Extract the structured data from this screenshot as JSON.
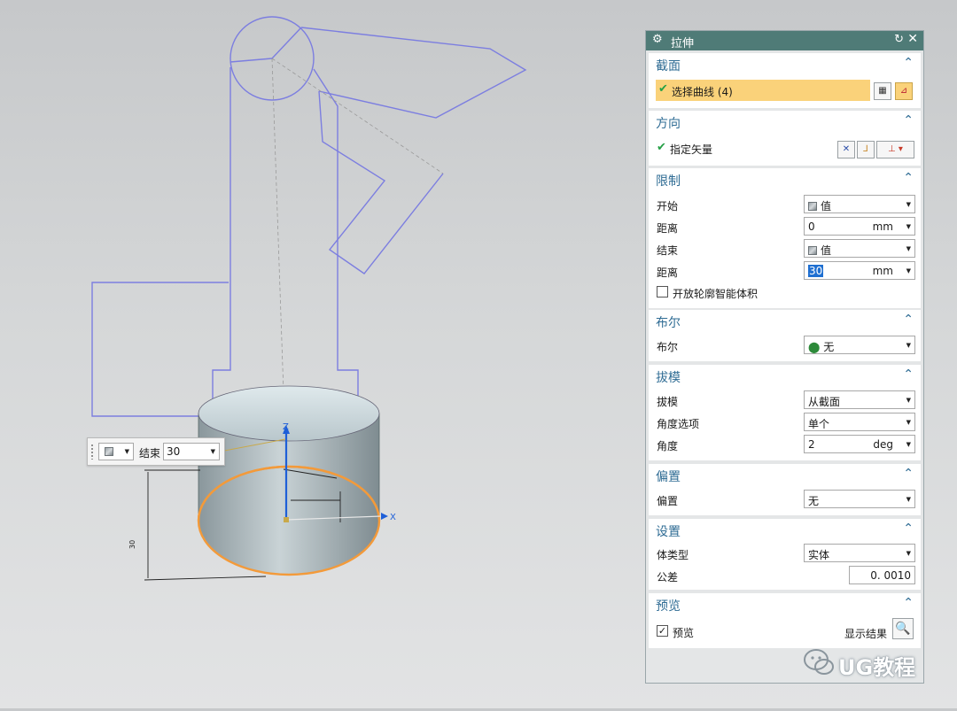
{
  "dialog": {
    "title": "拉伸",
    "sections": {
      "section": {
        "title": "截面",
        "select_curve": "选择曲线 (4)"
      },
      "direction": {
        "title": "方向",
        "specify_vector": "指定矢量"
      },
      "limits": {
        "title": "限制",
        "start_label": "开始",
        "start_value": "值",
        "distance1_label": "距离",
        "distance1_value": "0",
        "distance1_unit": "mm",
        "end_label": "结束",
        "end_value": "值",
        "distance2_label": "距离",
        "distance2_value": "30",
        "distance2_unit": "mm",
        "open_profile_label": "开放轮廓智能体积"
      },
      "boolean": {
        "title": "布尔",
        "label": "布尔",
        "value": "无"
      },
      "draft": {
        "title": "拔模",
        "draft_label": "拔模",
        "draft_value": "从截面",
        "angle_option_label": "角度选项",
        "angle_option_value": "单个",
        "angle_label": "角度",
        "angle_value": "2",
        "angle_unit": "deg"
      },
      "offset": {
        "title": "偏置",
        "label": "偏置",
        "value": "无"
      },
      "settings": {
        "title": "设置",
        "body_type_label": "体类型",
        "body_type_value": "实体",
        "tolerance_label": "公差",
        "tolerance_value": "0. 0010"
      },
      "preview": {
        "title": "预览",
        "preview_label": "预览",
        "show_result_label": "显示结果"
      }
    }
  },
  "mini_toolbar": {
    "label": "结束",
    "value": "30"
  },
  "viewport": {
    "axis_x": "X",
    "axis_z": "Z"
  },
  "watermark": {
    "text": "UG教程"
  },
  "colors": {
    "title_bar": "#4f7b77",
    "section_title": "#2f6c94",
    "selection_bar": "#fad27a",
    "sketch_line": "#7c7ee0",
    "highlight_edge": "#f39a3a"
  }
}
